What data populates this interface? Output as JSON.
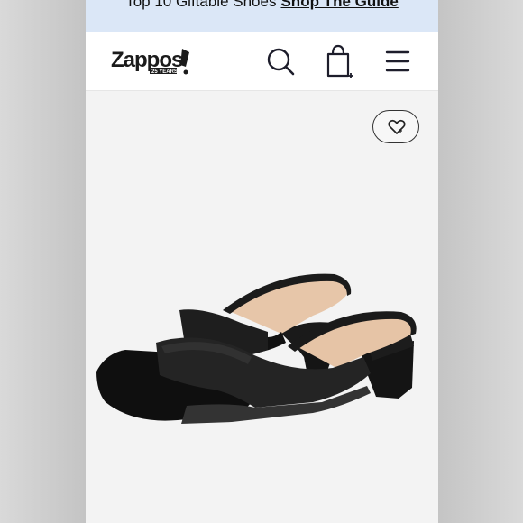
{
  "promo": {
    "text": "Top 10 Giftable Shoes",
    "link": "Shop The Guide"
  },
  "header": {
    "logo_text": "Zappos",
    "logo_badge": "25 YEARS",
    "icons": [
      "search-icon",
      "shopping-bag-icon",
      "hamburger-menu-icon"
    ]
  },
  "product": {
    "favorite_icon": "heart-plus-icon",
    "image": "black leather square-toe block-heel slide sandals"
  },
  "colors": {
    "promo_bg": "#dbe7f7",
    "header_bg": "#ffffff",
    "product_bg": "#f3f3f3",
    "shoe": "#1a1a1a",
    "lining": "#e8c9ae"
  }
}
